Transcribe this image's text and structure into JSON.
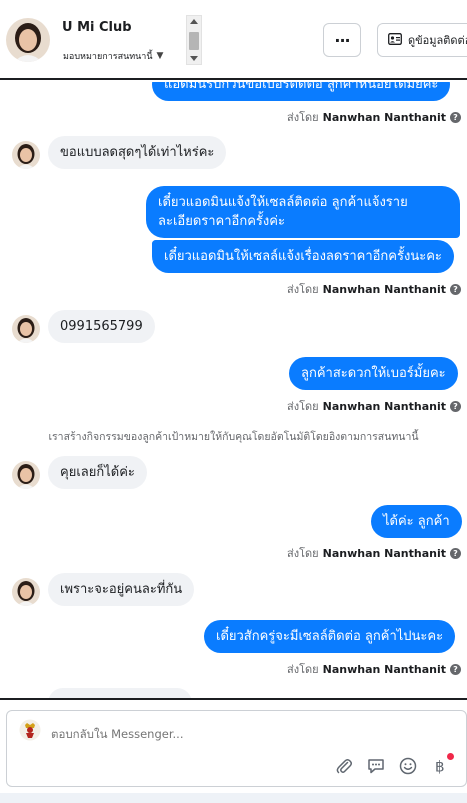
{
  "header": {
    "title": "U Mi Club",
    "assign_label": "มอบหมายการสนทนานี้",
    "more_label": "···",
    "info_label": "ดูข้อมูลติดต่อ"
  },
  "messages": {
    "m0_text": "แอดมินรบกวนขอเบอร์ติดต่อ ลูกค้าหน่อยได้มั้ยคะ",
    "m0_sent": "ส่งโดย",
    "m0_sender": "Nanwhan Nanthanit",
    "m1_text": "ขอแบบลดสุดๆได้เท่าไหร่คะ",
    "m2_text": "เดี๋ยวแอดมินแจ้งให้เซลล์ติดต่อ ลูกค้าแจ้งราย ละเอียดราคาอีกครั้งค่ะ",
    "m3_text": "เดี๋ยวแอดมินให้เซลล์แจ้งเรื่องลดราคาอีกครั้งนะคะ",
    "m3_sent": "ส่งโดย",
    "m3_sender": "Nanwhan Nanthanit",
    "m4_text": "0991565799",
    "m5_text": "ลูกค้าสะดวกให้เบอร์มั้ยคะ",
    "m5_sent": "ส่งโดย",
    "m5_sender": "Nanwhan Nanthanit",
    "system_note": "เราสร้างกิจกรรมของลูกค้าเป้าหมายให้กับคุณโดยอัตโนมัติโดยอิงตามการสนทนานี้",
    "m6_text": "คุยเลยก็ได้ค่ะ",
    "m7_text": "ได้ค่ะ ลูกค้า",
    "m7_sent": "ส่งโดย",
    "m7_sender": "Nanwhan Nanthanit",
    "m8_text": "เพราะจะอยู่คนละที่กัน",
    "m9_text": "เดี๋ยวสักครู่จะมีเซลล์ติดต่อ ลูกค้าไปนะคะ",
    "m9_sent": "ส่งโดย",
    "m9_sender": "Nanwhan Nanthanit"
  },
  "composer": {
    "placeholder": "ตอบกลับใน Messenger..."
  },
  "icons": {
    "attach": "paperclip-icon",
    "saved_replies": "chat-bubble-icon",
    "emoji": "smiley-icon",
    "payment": "baht-icon"
  },
  "colors": {
    "outgoing_bubble": "#0a7cff",
    "incoming_bubble": "#f0f2f5",
    "notification_dot": "#f02849"
  }
}
